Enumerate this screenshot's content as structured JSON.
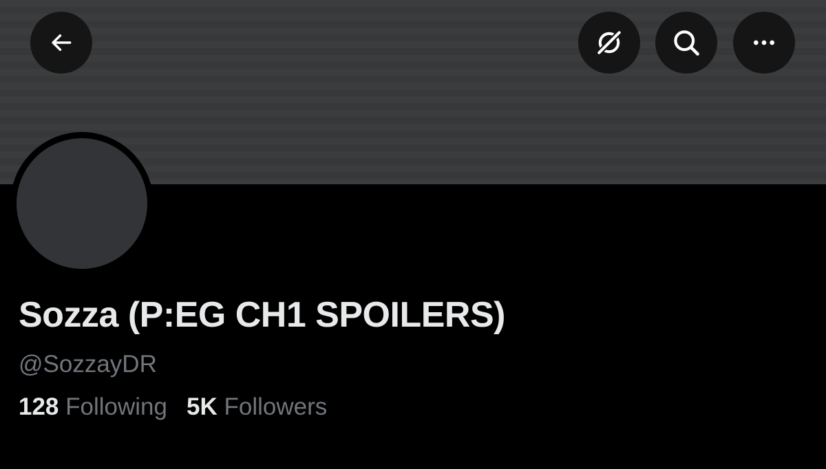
{
  "header": {
    "buttons": {
      "back": {
        "icon": "arrow-left-icon"
      },
      "grok": {
        "icon": "grok-icon"
      },
      "search": {
        "icon": "search-icon"
      },
      "more": {
        "icon": "more-horizontal-icon"
      }
    }
  },
  "profile": {
    "display_name": "Sozza (P:EG CH1 SPOILERS)",
    "handle": "@SozzayDR",
    "stats": {
      "following_count": "128",
      "following_label": "Following",
      "followers_count": "5K",
      "followers_label": "Followers"
    }
  },
  "colors": {
    "background": "#000000",
    "banner": "#3a3b3d",
    "avatar": "#333437",
    "button_bg": "#151515",
    "primary_text": "#e7e9ea",
    "secondary_text": "#71767b"
  }
}
